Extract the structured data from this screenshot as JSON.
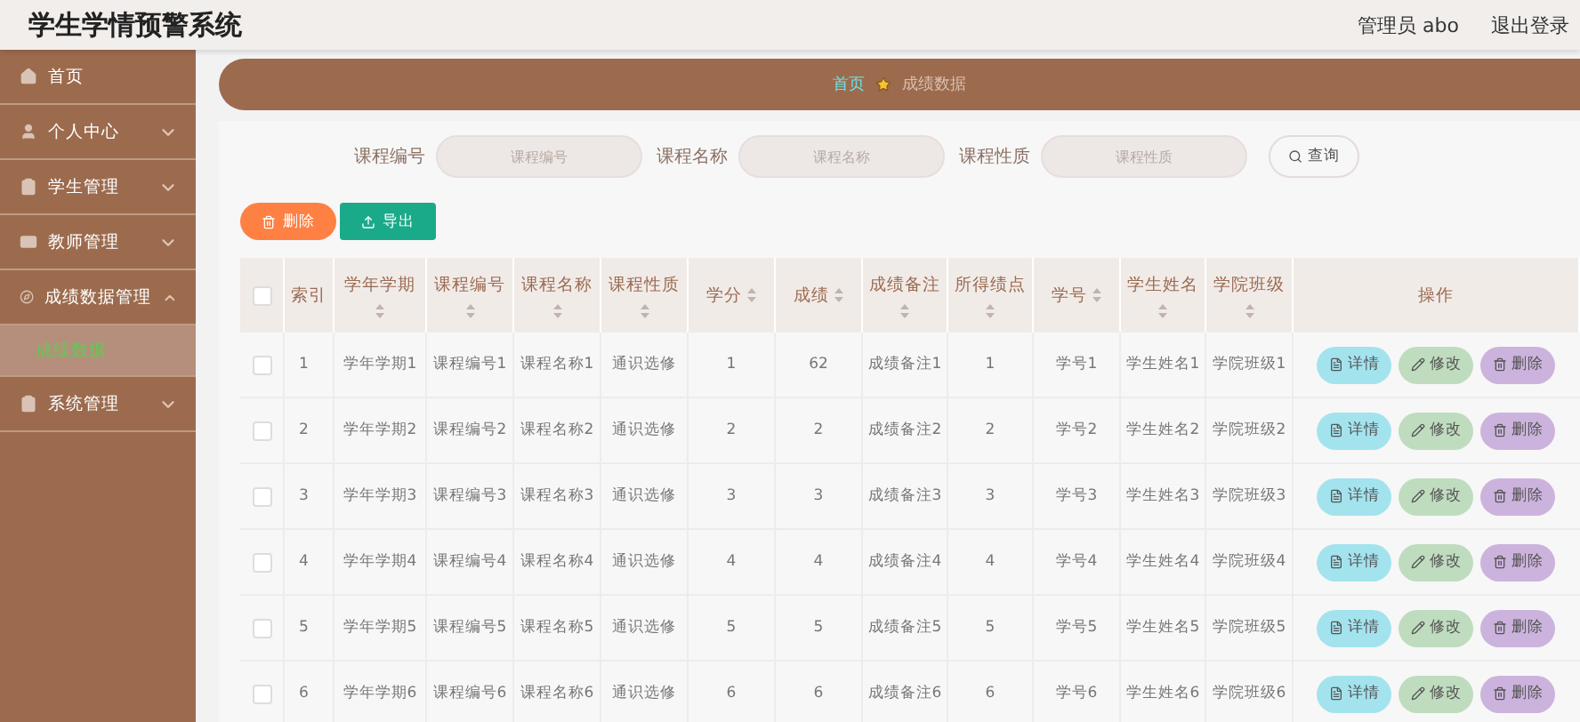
{
  "header": {
    "title": "学生学情预警系统",
    "user": "管理员 abo",
    "logout": "退出登录"
  },
  "sidebar": {
    "items": [
      {
        "label": "首页",
        "kind": "link"
      },
      {
        "label": "个人中心",
        "kind": "submenu",
        "expanded": false
      },
      {
        "label": "学生管理",
        "kind": "submenu",
        "expanded": false
      },
      {
        "label": "教师管理",
        "kind": "submenu",
        "expanded": false
      },
      {
        "label": "成绩数据管理",
        "kind": "submenu",
        "expanded": true,
        "children": [
          {
            "label": "成绩数据",
            "selected": true
          }
        ]
      },
      {
        "label": "系统管理",
        "kind": "submenu",
        "expanded": false
      }
    ]
  },
  "breadcrumb": [
    {
      "label": "首页",
      "kind": "link"
    },
    {
      "label": "成绩数据",
      "kind": "current"
    }
  ],
  "search": {
    "fields": [
      {
        "label": "课程编号",
        "placeholder": "课程编号"
      },
      {
        "label": "课程名称",
        "placeholder": "课程名称"
      },
      {
        "label": "课程性质",
        "placeholder": "课程性质"
      }
    ],
    "button": "查询"
  },
  "toolbar": [
    {
      "kind": "delete",
      "label": "删除"
    },
    {
      "kind": "export",
      "label": "导出"
    }
  ],
  "table": {
    "columns": [
      {
        "label": "索引",
        "sortable": false
      },
      {
        "label": "学年学期",
        "sortable": true
      },
      {
        "label": "课程编号",
        "sortable": true
      },
      {
        "label": "课程名称",
        "sortable": true
      },
      {
        "label": "课程性质",
        "sortable": true
      },
      {
        "label": "学分",
        "sortable": true
      },
      {
        "label": "成绩",
        "sortable": true
      },
      {
        "label": "成绩备注",
        "sortable": true
      },
      {
        "label": "所得绩点",
        "sortable": true
      },
      {
        "label": "学号",
        "sortable": true
      },
      {
        "label": "学生姓名",
        "sortable": true
      },
      {
        "label": "学院班级",
        "sortable": true
      },
      {
        "label": "操作",
        "sortable": false
      }
    ],
    "all_checked": false,
    "rows": [
      {
        "checked": false,
        "cells": [
          "1",
          "学年学期1",
          "课程编号1",
          "课程名称1",
          "通识选修",
          "1",
          "62",
          "成绩备注1",
          "1",
          "学号1",
          "学生姓名1",
          "学院班级1"
        ],
        "actions": [
          {
            "kind": "detail",
            "label": "详情"
          },
          {
            "kind": "edit",
            "label": "修改"
          },
          {
            "kind": "delete",
            "label": "删除"
          }
        ]
      },
      {
        "checked": false,
        "cells": [
          "2",
          "学年学期2",
          "课程编号2",
          "课程名称2",
          "通识选修",
          "2",
          "2",
          "成绩备注2",
          "2",
          "学号2",
          "学生姓名2",
          "学院班级2"
        ],
        "actions": [
          {
            "kind": "detail",
            "label": "详情"
          },
          {
            "kind": "edit",
            "label": "修改"
          },
          {
            "kind": "delete",
            "label": "删除"
          }
        ]
      },
      {
        "checked": false,
        "cells": [
          "3",
          "学年学期3",
          "课程编号3",
          "课程名称3",
          "通识选修",
          "3",
          "3",
          "成绩备注3",
          "3",
          "学号3",
          "学生姓名3",
          "学院班级3"
        ],
        "actions": [
          {
            "kind": "detail",
            "label": "详情"
          },
          {
            "kind": "edit",
            "label": "修改"
          },
          {
            "kind": "delete",
            "label": "删除"
          }
        ]
      },
      {
        "checked": false,
        "cells": [
          "4",
          "学年学期4",
          "课程编号4",
          "课程名称4",
          "通识选修",
          "4",
          "4",
          "成绩备注4",
          "4",
          "学号4",
          "学生姓名4",
          "学院班级4"
        ],
        "actions": [
          {
            "kind": "detail",
            "label": "详情"
          },
          {
            "kind": "edit",
            "label": "修改"
          },
          {
            "kind": "delete",
            "label": "删除"
          }
        ]
      },
      {
        "checked": false,
        "cells": [
          "5",
          "学年学期5",
          "课程编号5",
          "课程名称5",
          "通识选修",
          "5",
          "5",
          "成绩备注5",
          "5",
          "学号5",
          "学生姓名5",
          "学院班级5"
        ],
        "actions": [
          {
            "kind": "detail",
            "label": "详情"
          },
          {
            "kind": "edit",
            "label": "修改"
          },
          {
            "kind": "delete",
            "label": "删除"
          }
        ]
      },
      {
        "checked": false,
        "cells": [
          "6",
          "学年学期6",
          "课程编号6",
          "课程名称6",
          "通识选修",
          "6",
          "6",
          "成绩备注6",
          "6",
          "学号6",
          "学生姓名6",
          "学院班级6"
        ],
        "actions": [
          {
            "kind": "detail",
            "label": "详情"
          },
          {
            "kind": "edit",
            "label": "修改"
          },
          {
            "kind": "delete",
            "label": "删除"
          }
        ]
      }
    ]
  }
}
